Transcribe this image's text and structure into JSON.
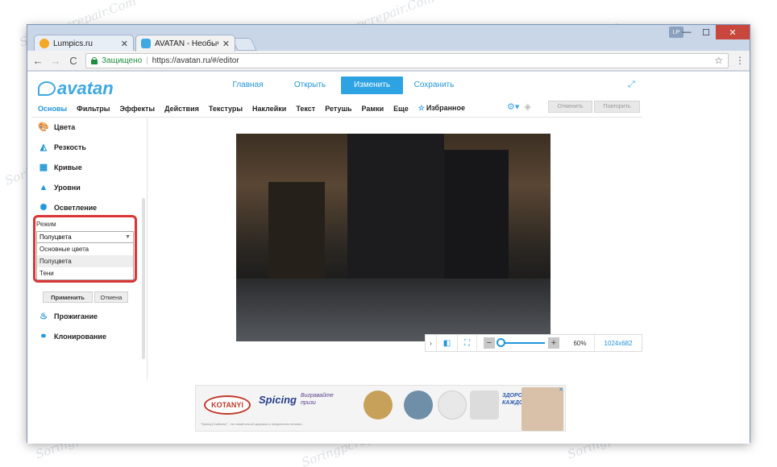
{
  "tabs": [
    {
      "title": "Lumpics.ru",
      "close": "✕"
    },
    {
      "title": "AVATAN - Необычный ф",
      "close": "✕"
    }
  ],
  "window": {
    "user_badge": "LP",
    "minimize": "—",
    "maximize": "☐",
    "close": "✕"
  },
  "toolbar": {
    "back": "←",
    "forward": "→",
    "reload": "C",
    "secure_label": "Защищено",
    "separator": "|",
    "url": "https://avatan.ru/#/editor",
    "star": "☆",
    "menu": "⋮"
  },
  "app": {
    "logo": "avatan",
    "main_nav": [
      "Главная",
      "Открыть",
      "Изменить",
      "Сохранить"
    ],
    "active_main": "Изменить",
    "sub_nav": [
      "Основы",
      "Фильтры",
      "Эффекты",
      "Действия",
      "Текстуры",
      "Наклейки",
      "Текст",
      "Ретушь",
      "Рамки",
      "Еще",
      "Избранное"
    ],
    "undo_label": "Отменить",
    "redo_label": "Повторить"
  },
  "sidebar": {
    "tools": [
      "Цвета",
      "Резкость",
      "Кривые",
      "Уровни",
      "Осветление",
      "Прожигание",
      "Клонирование"
    ],
    "mode_label": "Режим",
    "dropdown_value": "Полуцвета",
    "options": [
      "Основные цвета",
      "Полуцвета",
      "Тени"
    ],
    "selected_option": "Полуцвета",
    "apply_label": "Применить",
    "cancel_label": "Отмена"
  },
  "zoom": {
    "level": "60%",
    "size": "1024x682",
    "minus": "−",
    "plus": "+"
  },
  "ad": {
    "brand": "KOTANYI",
    "product": "Spicing",
    "promo": "Вигравайте призи",
    "slogan": "ЗДОРОВЫЙ ВКУС КАЖДОГО ДНЯ",
    "fine_print": "\"Spicing (Спайсинг)\" - это новый способ здорового и натурального питания...",
    "close": "✕"
  },
  "watermark": "Soringpcrepair.Com",
  "colors": {
    "accent": "#2196d9",
    "highlight": "#d93535"
  }
}
